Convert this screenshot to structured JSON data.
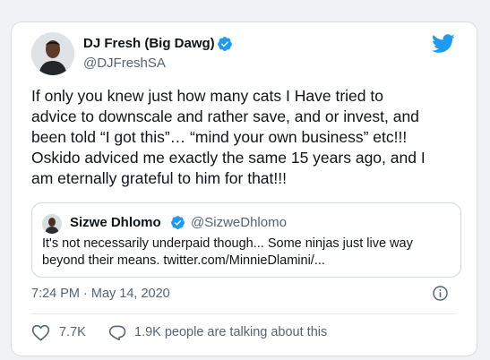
{
  "colors": {
    "twitter_blue": "#1d9bf0",
    "text_primary": "#0f1419",
    "text_secondary": "#536471",
    "border": "#cfd9de"
  },
  "author": {
    "display_name": "DJ Fresh (Big Dawg)",
    "handle": "@DJFreshSA",
    "verified": true
  },
  "tweet": {
    "text_lines": [
      "If only you knew just how many cats  I Have tried to",
      "advice to downscale and rather save, and or invest, and",
      "been told “I got this”… “mind your own business” etc!!!",
      "Oskido adviced me exactly the same 15 years ago, and I",
      "am eternally grateful to him for that!!!"
    ]
  },
  "quoted_tweet": {
    "display_name": "Sizwe Dhlomo",
    "handle": "@SizweDhlomo",
    "verified": true,
    "text_lines": [
      "It's not necessarily underpaid though... Some ninjas just live way",
      "beyond their means. twitter.com/MinnieDlamini/..."
    ]
  },
  "timestamp": "7:24 PM · May 14, 2020",
  "actions": {
    "like_count": "7.7K",
    "reply_text": "1.9K people are talking about this"
  },
  "icons": {
    "verified": "verified-badge-icon",
    "logo": "twitter-bird-icon",
    "info": "info-icon",
    "like": "heart-icon",
    "reply": "speech-bubble-icon"
  }
}
